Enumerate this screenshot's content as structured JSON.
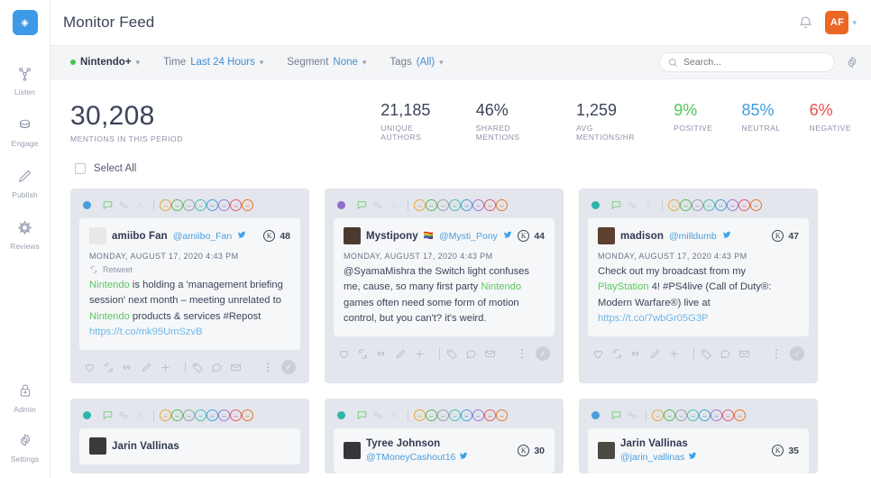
{
  "sidebar": {
    "logo_icon": "sprinklr-logo-icon",
    "items": [
      {
        "label": "Listen",
        "icon": "listen-icon"
      },
      {
        "label": "Engage",
        "icon": "engage-icon"
      },
      {
        "label": "Publish",
        "icon": "publish-pencil-icon"
      },
      {
        "label": "Reviews",
        "icon": "reviews-icon"
      }
    ],
    "bottom_items": [
      {
        "label": "Admin",
        "icon": "lock-icon"
      },
      {
        "label": "Settings",
        "icon": "gear-icon"
      }
    ]
  },
  "header": {
    "title": "Monitor Feed",
    "bell_icon": "notification-bell-icon",
    "avatar_initials": "AF",
    "avatar_color": "#ec6724",
    "avatar_chevron_icon": "chevron-down-icon"
  },
  "filters": {
    "workspace": {
      "label": "Nintendo+",
      "dot_color": "#44c44a",
      "chevron": "chevron-down-icon"
    },
    "time": {
      "key": "Time",
      "value": "Last 24 Hours",
      "chevron": "chevron-down-icon"
    },
    "segment": {
      "key": "Segment",
      "value": "None",
      "chevron": "chevron-down-icon"
    },
    "tags": {
      "key": "Tags",
      "value": "(All)",
      "chevron": "chevron-down-icon"
    },
    "search": {
      "placeholder": "Search...",
      "value": "",
      "icon": "search-icon"
    },
    "settings_icon": "gear-icon"
  },
  "metrics": {
    "primary": {
      "value": "30,208",
      "label": "MENTIONS IN THIS PERIOD"
    },
    "items": [
      {
        "value": "21,185",
        "label": "UNIQUE AUTHORS",
        "color": "#3c4459"
      },
      {
        "value": "46%",
        "label": "SHARED MENTIONS",
        "color": "#3c4459"
      },
      {
        "value": "1,259",
        "label": "AVG MENTIONS/HR",
        "color": "#3c4459"
      },
      {
        "value": "9%",
        "label": "POSITIVE",
        "color": "#4cc85a"
      },
      {
        "value": "85%",
        "label": "NEUTRAL",
        "color": "#3f9ee0"
      },
      {
        "value": "6%",
        "label": "NEGATIVE",
        "color": "#ea4f4f"
      }
    ]
  },
  "select_all": {
    "label": "Select All",
    "checked": false
  },
  "card_toolbar": {
    "mini_icons": [
      "message-icon",
      "share-icon",
      "person-icon"
    ],
    "emoji_colors": [
      "#e8a93a",
      "#5cb85c",
      "#9aa0b1",
      "#4cc0b0",
      "#4a9edb",
      "#9b7ad1",
      "#e05c6e",
      "#e8762a"
    ],
    "emoji_names": [
      "smile-emoji",
      "laugh-emoji",
      "neutral-emoji",
      "surprised-emoji",
      "sad-emoji",
      "sick-emoji",
      "angry-emoji",
      "grin-emoji"
    ]
  },
  "card_footer": {
    "icons": [
      "heart-icon",
      "retweet-icon",
      "quote-icon",
      "pencil-icon",
      "plus-icon"
    ],
    "icons2": [
      "tag-icon",
      "comment-icon",
      "envelope-icon"
    ],
    "kebab_icon": "kebab-menu-icon",
    "check_icon": "check-circle-icon"
  },
  "cards": [
    {
      "dot_color": "#4a9edb",
      "author": "amiibo Fan",
      "handle": "@amiibo_Fan",
      "verified_icon": "twitter-icon",
      "klout": "48",
      "timestamp": "MONDAY, AUGUST 17, 2020 4:43 PM",
      "retweet_label": "Retweet",
      "has_retweet": true,
      "body_parts": [
        {
          "t": "Nintendo",
          "s": "hl"
        },
        {
          "t": " is holding a 'management briefing session' next month – meeting unrelated to ",
          "s": ""
        },
        {
          "t": "Nintendo",
          "s": "hl"
        },
        {
          "t": " products & services #Repost ",
          "s": ""
        },
        {
          "t": "https://t.co/mk95UmSzvB",
          "s": "lnk"
        }
      ],
      "pfp_color": "#e8e8e8",
      "show_footer": true
    },
    {
      "dot_color": "#8e6fd0",
      "author": "Mystipony",
      "author_flag": "rainbow-flag-icon",
      "handle": "@Mysti_Pony",
      "verified_icon": "twitter-icon",
      "klout": "44",
      "timestamp": "MONDAY, AUGUST 17, 2020 4:43 PM",
      "has_retweet": false,
      "body_parts": [
        {
          "t": "@SyamaMishra the Switch light confuses me, cause, so many first party ",
          "s": ""
        },
        {
          "t": "Nintendo",
          "s": "hl"
        },
        {
          "t": " games often need some form of motion control, but you can't? it's weird.",
          "s": ""
        }
      ],
      "pfp_color": "#4a3b32",
      "show_footer": true
    },
    {
      "dot_color": "#2cb5a8",
      "author": "madison",
      "handle": "@milldumb",
      "verified_icon": "twitter-icon",
      "klout": "47",
      "timestamp": "MONDAY, AUGUST 17, 2020 4:43 PM",
      "has_retweet": false,
      "body_parts": [
        {
          "t": "Check out my broadcast from my ",
          "s": ""
        },
        {
          "t": "PlayStation",
          "s": "hl"
        },
        {
          "t": " 4! #PS4live (Call of Duty®: Modern Warfare®) live at ",
          "s": ""
        },
        {
          "t": "https://t.co/7wbGr05G3P",
          "s": "lnk"
        }
      ],
      "pfp_color": "#5d4030",
      "show_footer": true
    },
    {
      "dot_color": "#2cb5a8",
      "author": "Jarin Vallinas",
      "handle": "",
      "klout": "",
      "timestamp": "",
      "has_retweet": false,
      "body_parts": [],
      "pfp_color": "#3a3a3a",
      "show_footer": false,
      "clipped": true
    },
    {
      "dot_color": "#2cb5a8",
      "author": "Tyree Johnson",
      "handle": "@TMoneyCashout16",
      "verified_icon": "twitter-icon",
      "klout": "30",
      "timestamp": "",
      "has_retweet": false,
      "body_parts": [],
      "pfp_color": "#35353a",
      "show_footer": false,
      "clipped": true,
      "stacked_handle": true
    },
    {
      "dot_color": "#4a9edb",
      "author": "Jarin Vallinas",
      "handle": "@jarin_vallinas",
      "verified_icon": "twitter-icon",
      "klout": "35",
      "timestamp": "",
      "has_retweet": false,
      "body_parts": [],
      "pfp_color": "#4a4a42",
      "show_footer": false,
      "clipped": true,
      "stacked_handle": true,
      "short_emoji": true
    }
  ]
}
